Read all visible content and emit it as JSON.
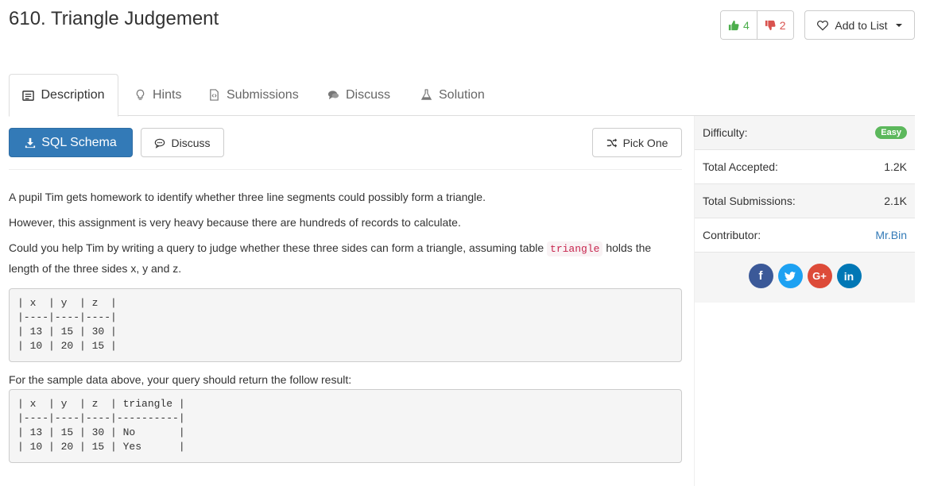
{
  "header": {
    "title": "610. Triangle Judgement",
    "upvotes": "4",
    "downvotes": "2",
    "add_to_list": "Add to List"
  },
  "tabs": [
    {
      "label": "Description",
      "icon": "description-icon"
    },
    {
      "label": "Hints",
      "icon": "lightbulb-icon"
    },
    {
      "label": "Submissions",
      "icon": "code-file-icon"
    },
    {
      "label": "Discuss",
      "icon": "comments-icon"
    },
    {
      "label": "Solution",
      "icon": "flask-icon"
    }
  ],
  "toolbar": {
    "schema_label": "SQL Schema",
    "discuss_label": "Discuss",
    "pick_one_label": "Pick One"
  },
  "description": {
    "p1": "A pupil Tim gets homework to identify whether three line segments could possibly form a triangle.",
    "p2": "However, this assignment is very heavy because there are hundreds of records to calculate.",
    "p3_before": "Could you help Tim by writing a query to judge whether these three sides can form a triangle, assuming table ",
    "p3_code": "triangle",
    "p3_after": " holds the length of the three sides x, y and z.",
    "table1": "| x  | y  | z  |\n|----|----|----|\n| 13 | 15 | 30 |\n| 10 | 20 | 15 |",
    "p4": "For the sample data above, your query should return the follow result:",
    "table2": "| x  | y  | z  | triangle |\n|----|----|----|----------|\n| 13 | 15 | 30 | No       |\n| 10 | 20 | 15 | Yes      |"
  },
  "sidebar": {
    "difficulty_label": "Difficulty:",
    "difficulty_value": "Easy",
    "accepted_label": "Total Accepted:",
    "accepted_value": "1.2K",
    "submissions_label": "Total Submissions:",
    "submissions_value": "2.1K",
    "contributor_label": "Contributor:",
    "contributor_value": "Mr.Bin"
  },
  "socials": [
    {
      "name": "facebook",
      "glyph": "f",
      "color": "#3b5998"
    },
    {
      "name": "twitter",
      "glyph": "t",
      "color": "#1da1f2"
    },
    {
      "name": "google-plus",
      "glyph": "G+",
      "color": "#dd4b39"
    },
    {
      "name": "linkedin",
      "glyph": "in",
      "color": "#0077b5"
    }
  ],
  "colors": {
    "primary": "#337ab7",
    "upvote": "#4cae4c",
    "downvote": "#d9534f",
    "easy": "#5cb85c"
  }
}
